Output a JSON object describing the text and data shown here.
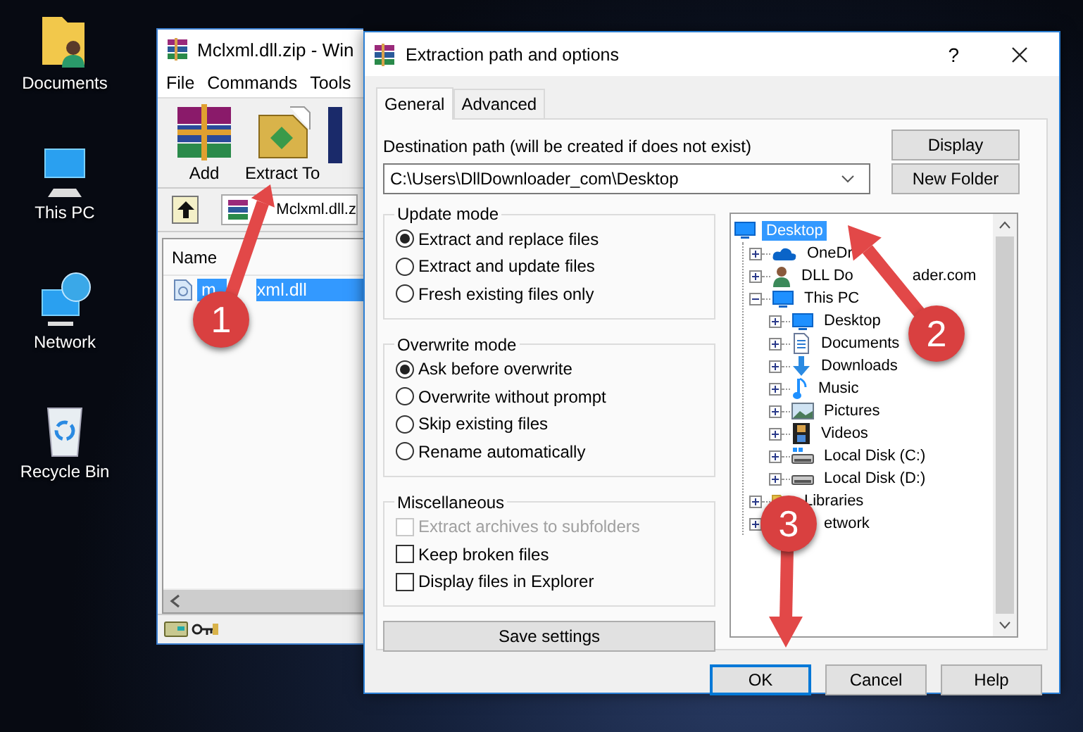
{
  "desktop_icons": [
    {
      "label": "Documents"
    },
    {
      "label": "This PC"
    },
    {
      "label": "Network"
    },
    {
      "label": "Recycle Bin"
    }
  ],
  "archive_window": {
    "title": "Mclxml.dll.zip - Win",
    "menu": [
      "File",
      "Commands",
      "Tools"
    ],
    "toolbar": [
      "Add",
      "Extract To"
    ],
    "path": "Mclxml.dll.z",
    "columns": [
      "Name"
    ],
    "files": [
      {
        "name_parts": [
          "m",
          "xml.dll"
        ],
        "selected": true
      }
    ]
  },
  "dialog": {
    "title": "Extraction path and options",
    "help_button": "?",
    "tabs": [
      {
        "label": "General",
        "selected": true
      },
      {
        "label": "Advanced",
        "selected": false
      }
    ],
    "destination": {
      "label": "Destination path (will be created if does not exist)",
      "value": "C:\\Users\\DllDownloader_com\\Desktop"
    },
    "side_buttons": [
      "Display",
      "New Folder"
    ],
    "groups": [
      {
        "kind": "radio",
        "title": "Update mode",
        "options": [
          {
            "label": "Extract and replace files",
            "selected": true
          },
          {
            "label": "Extract and update files",
            "selected": false
          },
          {
            "label": "Fresh existing files only",
            "selected": false
          }
        ]
      },
      {
        "kind": "radio",
        "title": "Overwrite mode",
        "options": [
          {
            "label": "Ask before overwrite",
            "selected": true
          },
          {
            "label": "Overwrite without prompt",
            "selected": false
          },
          {
            "label": "Skip existing files",
            "selected": false
          },
          {
            "label": "Rename automatically",
            "selected": false
          }
        ]
      },
      {
        "kind": "checkbox",
        "title": "Miscellaneous",
        "options": [
          {
            "label": "Extract archives to subfolders",
            "checked": false,
            "disabled": true
          },
          {
            "label": "Keep broken files",
            "checked": false,
            "disabled": false
          },
          {
            "label": "Display files in Explorer",
            "checked": false,
            "disabled": false
          }
        ]
      }
    ],
    "save_button": "Save settings",
    "tree": [
      {
        "label": "Desktop",
        "selected": true,
        "children": [
          {
            "label": "OneDr",
            "selected": false,
            "expanded": false
          },
          {
            "label_parts": [
              "DLL Do",
              "ader.com"
            ],
            "selected": false,
            "expanded": false
          },
          {
            "label": "This PC",
            "selected": false,
            "expanded": true,
            "children": [
              {
                "label": "Desktop",
                "selected": false,
                "expanded": false
              },
              {
                "label": "Documents",
                "selected": false,
                "expanded": false
              },
              {
                "label": "Downloads",
                "selected": false,
                "expanded": false
              },
              {
                "label": "Music",
                "selected": false,
                "expanded": false
              },
              {
                "label": "Pictures",
                "selected": false,
                "expanded": false
              },
              {
                "label": "Videos",
                "selected": false,
                "expanded": false
              },
              {
                "label": "Local Disk (C:)",
                "selected": false,
                "expanded": false
              },
              {
                "label": "Local Disk (D:)",
                "selected": false,
                "expanded": false
              }
            ]
          },
          {
            "label": "Libraries",
            "selected": false,
            "expanded": false
          },
          {
            "label": "etwork",
            "selected": false,
            "expanded": false
          }
        ]
      }
    ],
    "buttons": [
      {
        "label": "OK",
        "default": true
      },
      {
        "label": "Cancel",
        "default": false
      },
      {
        "label": "Help",
        "default": false
      }
    ]
  },
  "annotations": [
    {
      "number": "1"
    },
    {
      "number": "2"
    },
    {
      "number": "3"
    }
  ]
}
